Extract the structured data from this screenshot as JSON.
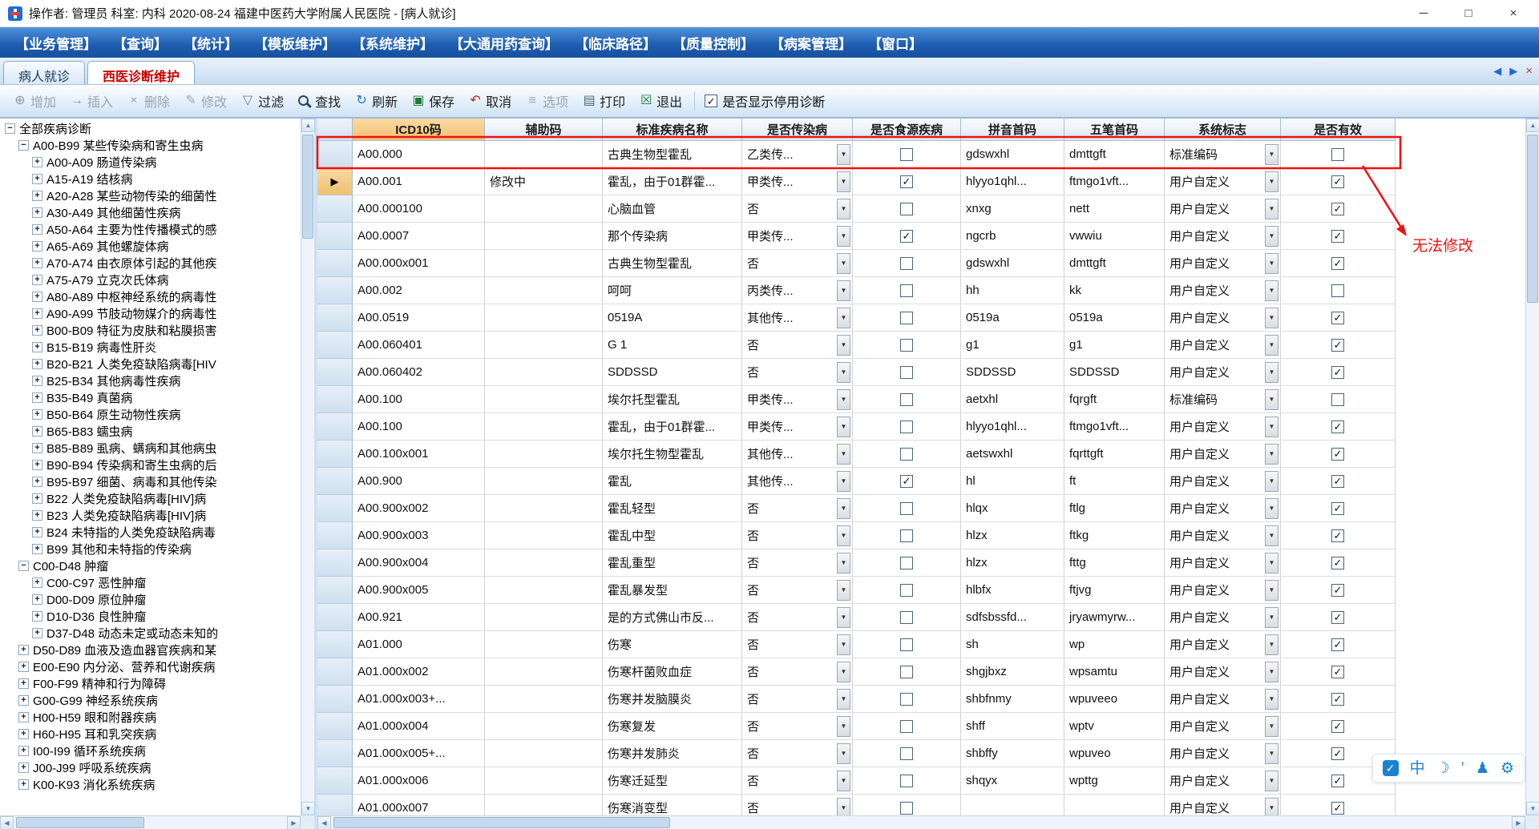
{
  "window": {
    "title": "操作者: 管理员 科室: 内科  2020-08-24  福建中医药大学附属人民医院 - [病人就诊]"
  },
  "menubar": {
    "items": [
      "【业务管理】",
      "【查询】",
      "【统计】",
      "【模板维护】",
      "【系统维护】",
      "【大通用药查询】",
      "【临床路径】",
      "【质量控制】",
      "【病案管理】",
      "【窗口】"
    ]
  },
  "tabs": {
    "items": [
      {
        "label": "病人就诊",
        "active": false
      },
      {
        "label": "西医诊断维护",
        "active": true
      }
    ]
  },
  "toolbar": {
    "buttons": [
      {
        "label": "增加",
        "icon": "add-icon",
        "enabled": false
      },
      {
        "label": "插入",
        "icon": "insert-icon",
        "enabled": false
      },
      {
        "label": "删除",
        "icon": "delete-icon",
        "enabled": false
      },
      {
        "label": "修改",
        "icon": "modify-icon",
        "enabled": false
      },
      {
        "label": "过滤",
        "icon": "filter-icon",
        "enabled": true
      },
      {
        "label": "查找",
        "icon": "find-icon",
        "enabled": true
      },
      {
        "label": "刷新",
        "icon": "refresh-icon",
        "enabled": true
      },
      {
        "label": "保存",
        "icon": "save-icon",
        "enabled": true
      },
      {
        "label": "取消",
        "icon": "cancel-icon",
        "enabled": true
      },
      {
        "label": "选项",
        "icon": "options-icon",
        "enabled": false
      },
      {
        "label": "打印",
        "icon": "print-icon",
        "enabled": true
      },
      {
        "label": "退出",
        "icon": "exit-icon",
        "enabled": true
      }
    ],
    "show_disabled": {
      "label": "是否显示停用诊断",
      "checked": true
    }
  },
  "tree": {
    "items": [
      {
        "level": 0,
        "expand": "minus",
        "label": "全部疾病诊断"
      },
      {
        "level": 1,
        "expand": "minus",
        "label": "A00-B99  某些传染病和寄生虫病"
      },
      {
        "level": 2,
        "expand": "plus",
        "label": "A00-A09  肠道传染病"
      },
      {
        "level": 2,
        "expand": "plus",
        "label": "A15-A19  结核病"
      },
      {
        "level": 2,
        "expand": "plus",
        "label": "A20-A28  某些动物传染的细菌性"
      },
      {
        "level": 2,
        "expand": "plus",
        "label": "A30-A49  其他细菌性疾病"
      },
      {
        "level": 2,
        "expand": "plus",
        "label": "A50-A64  主要为性传播模式的感"
      },
      {
        "level": 2,
        "expand": "plus",
        "label": "A65-A69  其他螺旋体病"
      },
      {
        "level": 2,
        "expand": "plus",
        "label": "A70-A74  由衣原体引起的其他疾"
      },
      {
        "level": 2,
        "expand": "plus",
        "label": "A75-A79  立克次氏体病"
      },
      {
        "level": 2,
        "expand": "plus",
        "label": "A80-A89  中枢神经系统的病毒性"
      },
      {
        "level": 2,
        "expand": "plus",
        "label": "A90-A99  节肢动物媒介的病毒性"
      },
      {
        "level": 2,
        "expand": "plus",
        "label": "B00-B09  特征为皮肤和粘膜损害"
      },
      {
        "level": 2,
        "expand": "plus",
        "label": "B15-B19  病毒性肝炎"
      },
      {
        "level": 2,
        "expand": "plus",
        "label": "B20-B21  人类免疫缺陷病毒[HIV"
      },
      {
        "level": 2,
        "expand": "plus",
        "label": "B25-B34  其他病毒性疾病"
      },
      {
        "level": 2,
        "expand": "plus",
        "label": "B35-B49  真菌病"
      },
      {
        "level": 2,
        "expand": "plus",
        "label": "B50-B64  原生动物性疾病"
      },
      {
        "level": 2,
        "expand": "plus",
        "label": "B65-B83  蠕虫病"
      },
      {
        "level": 2,
        "expand": "plus",
        "label": "B85-B89  虱病、螨病和其他病虫"
      },
      {
        "level": 2,
        "expand": "plus",
        "label": "B90-B94  传染病和寄生虫病的后"
      },
      {
        "level": 2,
        "expand": "plus",
        "label": "B95-B97  细菌、病毒和其他传染"
      },
      {
        "level": 2,
        "expand": "plus",
        "label": "B22  人类免疫缺陷病毒[HIV]病"
      },
      {
        "level": 2,
        "expand": "plus",
        "label": "B23  人类免疫缺陷病毒[HIV]病"
      },
      {
        "level": 2,
        "expand": "plus",
        "label": "B24  未特指的人类免疫缺陷病毒"
      },
      {
        "level": 2,
        "expand": "plus",
        "label": "B99  其他和未特指的传染病"
      },
      {
        "level": 1,
        "expand": "minus",
        "label": "C00-D48  肿瘤"
      },
      {
        "level": 2,
        "expand": "plus",
        "label": "C00-C97  恶性肿瘤"
      },
      {
        "level": 2,
        "expand": "plus",
        "label": "D00-D09  原位肿瘤"
      },
      {
        "level": 2,
        "expand": "plus",
        "label": "D10-D36  良性肿瘤"
      },
      {
        "level": 2,
        "expand": "plus",
        "label": "D37-D48  动态未定或动态未知的"
      },
      {
        "level": 1,
        "expand": "plus",
        "label": "D50-D89  血液及造血器官疾病和某"
      },
      {
        "level": 1,
        "expand": "plus",
        "label": "E00-E90  内分泌、营养和代谢疾病"
      },
      {
        "level": 1,
        "expand": "plus",
        "label": "F00-F99  精神和行为障碍"
      },
      {
        "level": 1,
        "expand": "plus",
        "label": "G00-G99  神经系统疾病"
      },
      {
        "level": 1,
        "expand": "plus",
        "label": "H00-H59  眼和附器疾病"
      },
      {
        "level": 1,
        "expand": "plus",
        "label": "H60-H95  耳和乳突疾病"
      },
      {
        "level": 1,
        "expand": "plus",
        "label": "I00-I99  循环系统疾病"
      },
      {
        "level": 1,
        "expand": "plus",
        "label": "J00-J99  呼吸系统疾病"
      },
      {
        "level": 1,
        "expand": "plus",
        "label": "K00-K93  消化系统疾病"
      }
    ]
  },
  "table": {
    "columns": [
      "ICD10码",
      "辅助码",
      "标准疾病名称",
      "是否传染病",
      "是否食源疾病",
      "拼音首码",
      "五笔首码",
      "系统标志",
      "是否有效"
    ],
    "rows": [
      {
        "current": false,
        "icd10": "A00.000",
        "aux": "",
        "name": "古典生物型霍乱",
        "infectious": "乙类传...",
        "foodborne": false,
        "pinyin": "gdswxhl",
        "wubi": "dmttgft",
        "sysflag": "标准编码",
        "valid": false
      },
      {
        "current": true,
        "icd10": "A00.001",
        "aux": "修改中",
        "name": "霍乱，由于01群霍...",
        "infectious": "甲类传...",
        "foodborne": true,
        "pinyin": "hlyyo1qhl...",
        "wubi": "ftmgo1vft...",
        "sysflag": "用户自定义",
        "valid": true
      },
      {
        "current": false,
        "icd10": "A00.000100",
        "aux": "",
        "name": "心脑血管",
        "infectious": "否",
        "foodborne": false,
        "pinyin": "xnxg",
        "wubi": "nett",
        "sysflag": "用户自定义",
        "valid": true
      },
      {
        "current": false,
        "icd10": "A00.0007",
        "aux": "",
        "name": "那个传染病",
        "infectious": "甲类传...",
        "foodborne": true,
        "pinyin": "ngcrb",
        "wubi": "vwwiu",
        "sysflag": "用户自定义",
        "valid": true
      },
      {
        "current": false,
        "icd10": "A00.000x001",
        "aux": "",
        "name": "古典生物型霍乱",
        "infectious": "否",
        "foodborne": false,
        "pinyin": "gdswxhl",
        "wubi": "dmttgft",
        "sysflag": "用户自定义",
        "valid": true
      },
      {
        "current": false,
        "icd10": "A00.002",
        "aux": "",
        "name": "呵呵",
        "infectious": "丙类传...",
        "foodborne": false,
        "pinyin": "hh",
        "wubi": "kk",
        "sysflag": "用户自定义",
        "valid": false
      },
      {
        "current": false,
        "icd10": "A00.0519",
        "aux": "",
        "name": "0519A",
        "infectious": "其他传...",
        "foodborne": false,
        "pinyin": "0519a",
        "wubi": "0519a",
        "sysflag": "用户自定义",
        "valid": true
      },
      {
        "current": false,
        "icd10": "A00.060401",
        "aux": "",
        "name": "G 1",
        "infectious": "否",
        "foodborne": false,
        "pinyin": "g1",
        "wubi": "g1",
        "sysflag": "用户自定义",
        "valid": true
      },
      {
        "current": false,
        "icd10": "A00.060402",
        "aux": "",
        "name": "SDDSSD",
        "infectious": "否",
        "foodborne": false,
        "pinyin": "SDDSSD",
        "wubi": "SDDSSD",
        "sysflag": "用户自定义",
        "valid": true
      },
      {
        "current": false,
        "icd10": "A00.100",
        "aux": "",
        "name": "埃尔托型霍乱",
        "infectious": "甲类传...",
        "foodborne": false,
        "pinyin": "aetxhl",
        "wubi": "fqrgft",
        "sysflag": "标准编码",
        "valid": false
      },
      {
        "current": false,
        "icd10": "A00.100",
        "aux": "",
        "name": "霍乱，由于01群霍...",
        "infectious": "甲类传...",
        "foodborne": false,
        "pinyin": "hlyyo1qhl...",
        "wubi": "ftmgo1vft...",
        "sysflag": "用户自定义",
        "valid": true
      },
      {
        "current": false,
        "icd10": "A00.100x001",
        "aux": "",
        "name": "埃尔托生物型霍乱",
        "infectious": "其他传...",
        "foodborne": false,
        "pinyin": "aetswxhl",
        "wubi": "fqrttgft",
        "sysflag": "用户自定义",
        "valid": true
      },
      {
        "current": false,
        "icd10": "A00.900",
        "aux": "",
        "name": "霍乱",
        "infectious": "其他传...",
        "foodborne": true,
        "pinyin": "hl",
        "wubi": "ft",
        "sysflag": "用户自定义",
        "valid": true
      },
      {
        "current": false,
        "icd10": "A00.900x002",
        "aux": "",
        "name": "霍乱轻型",
        "infectious": "否",
        "foodborne": false,
        "pinyin": "hlqx",
        "wubi": "ftlg",
        "sysflag": "用户自定义",
        "valid": true
      },
      {
        "current": false,
        "icd10": "A00.900x003",
        "aux": "",
        "name": "霍乱中型",
        "infectious": "否",
        "foodborne": false,
        "pinyin": "hlzx",
        "wubi": "ftkg",
        "sysflag": "用户自定义",
        "valid": true
      },
      {
        "current": false,
        "icd10": "A00.900x004",
        "aux": "",
        "name": "霍乱重型",
        "infectious": "否",
        "foodborne": false,
        "pinyin": "hlzx",
        "wubi": "fttg",
        "sysflag": "用户自定义",
        "valid": true
      },
      {
        "current": false,
        "icd10": "A00.900x005",
        "aux": "",
        "name": "霍乱暴发型",
        "infectious": "否",
        "foodborne": false,
        "pinyin": "hlbfx",
        "wubi": "ftjvg",
        "sysflag": "用户自定义",
        "valid": true
      },
      {
        "current": false,
        "icd10": "A00.921",
        "aux": "",
        "name": "是的方式佛山市反...",
        "infectious": "否",
        "foodborne": false,
        "pinyin": "sdfsbssfd...",
        "wubi": "jryawmyrw...",
        "sysflag": "用户自定义",
        "valid": true
      },
      {
        "current": false,
        "icd10": "A01.000",
        "aux": "",
        "name": "伤寒",
        "infectious": "否",
        "foodborne": false,
        "pinyin": "sh",
        "wubi": "wp",
        "sysflag": "用户自定义",
        "valid": true
      },
      {
        "current": false,
        "icd10": "A01.000x002",
        "aux": "",
        "name": "伤寒杆菌败血症",
        "infectious": "否",
        "foodborne": false,
        "pinyin": "shgjbxz",
        "wubi": "wpsamtu",
        "sysflag": "用户自定义",
        "valid": true
      },
      {
        "current": false,
        "icd10": "A01.000x003+...",
        "aux": "",
        "name": "伤寒并发脑膜炎",
        "infectious": "否",
        "foodborne": false,
        "pinyin": "shbfnmy",
        "wubi": "wpuveeo",
        "sysflag": "用户自定义",
        "valid": true
      },
      {
        "current": false,
        "icd10": "A01.000x004",
        "aux": "",
        "name": "伤寒复发",
        "infectious": "否",
        "foodborne": false,
        "pinyin": "shff",
        "wubi": "wptv",
        "sysflag": "用户自定义",
        "valid": true
      },
      {
        "current": false,
        "icd10": "A01.000x005+...",
        "aux": "",
        "name": "伤寒并发肺炎",
        "infectious": "否",
        "foodborne": false,
        "pinyin": "shbffy",
        "wubi": "wpuveo",
        "sysflag": "用户自定义",
        "valid": true
      },
      {
        "current": false,
        "icd10": "A01.000x006",
        "aux": "",
        "name": "伤寒迁延型",
        "infectious": "否",
        "foodborne": false,
        "pinyin": "shqyx",
        "wubi": "wpttg",
        "sysflag": "用户自定义",
        "valid": true
      },
      {
        "current": false,
        "icd10": "A01.000x007",
        "aux": "",
        "name": "伤寒消变型",
        "infectious": "否",
        "foodborne": false,
        "pinyin": "",
        "wubi": "",
        "sysflag": "用户自定义",
        "valid": true
      }
    ]
  },
  "annotation": {
    "text": "无法修改",
    "color": "#ee1111"
  },
  "ime": {
    "mode_label": "中"
  }
}
